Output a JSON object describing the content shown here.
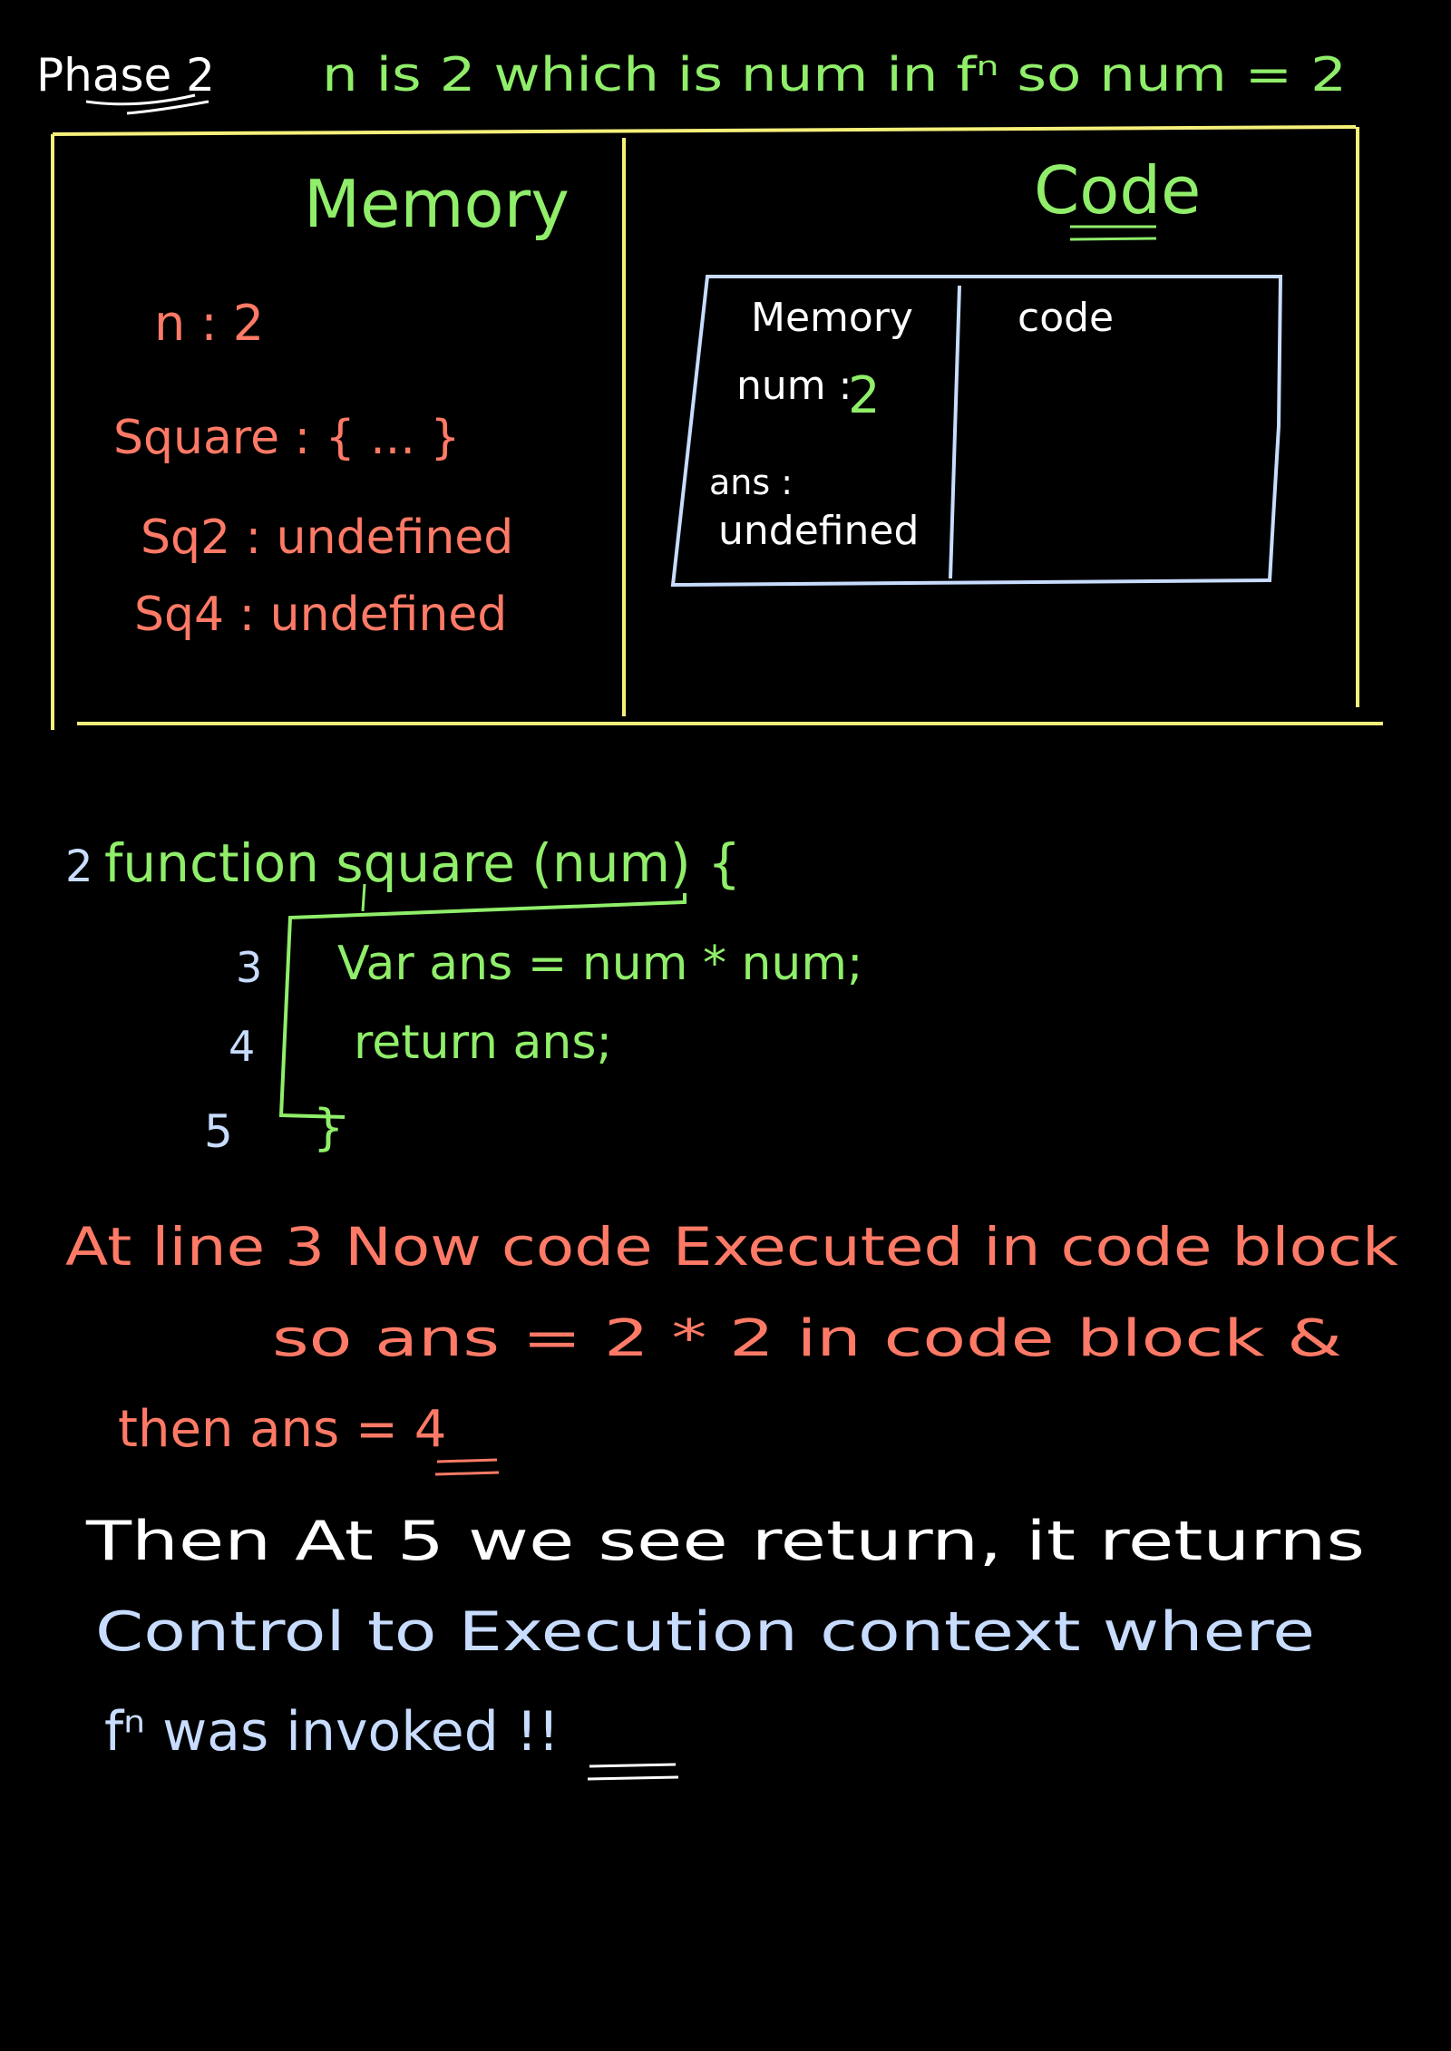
{
  "colors": {
    "background": "#000000",
    "white": "#ffffff",
    "green": "#90ee6a",
    "salmon": "#ff7a66",
    "yellow": "#f5f07a",
    "blue": "#c8dcff"
  },
  "header": {
    "phase_label": "Phase 2",
    "statement": "n is 2 which is num in fⁿ so num = 2"
  },
  "execution_context": {
    "memory_title": "Memory",
    "code_title": "Code",
    "memory_entries": [
      "n : 2",
      "Square : { ... }",
      "Sq2 : undefined",
      "Sq4 : undefined"
    ],
    "inner_context": {
      "memory_title": "Memory",
      "code_title": "code",
      "num_label": "num :",
      "num_value": "2",
      "ans_label": "ans :",
      "ans_value": "undefined"
    }
  },
  "code_listing": {
    "lines": [
      {
        "number": "2",
        "text": "function square (num) {"
      },
      {
        "number": "3",
        "text": "Var ans = num * num;"
      },
      {
        "number": "4",
        "text": "return ans;"
      },
      {
        "number": "5",
        "text": "}"
      }
    ]
  },
  "explanation": {
    "red_lines": [
      "At line 3  Now code Executed in code block",
      "so ans = 2 * 2 in code block &",
      "then ans = 4"
    ],
    "blue_lines": [
      "Then At 5 we see return, it returns",
      "Control to Execution context where",
      "fⁿ was invoked !!"
    ]
  }
}
